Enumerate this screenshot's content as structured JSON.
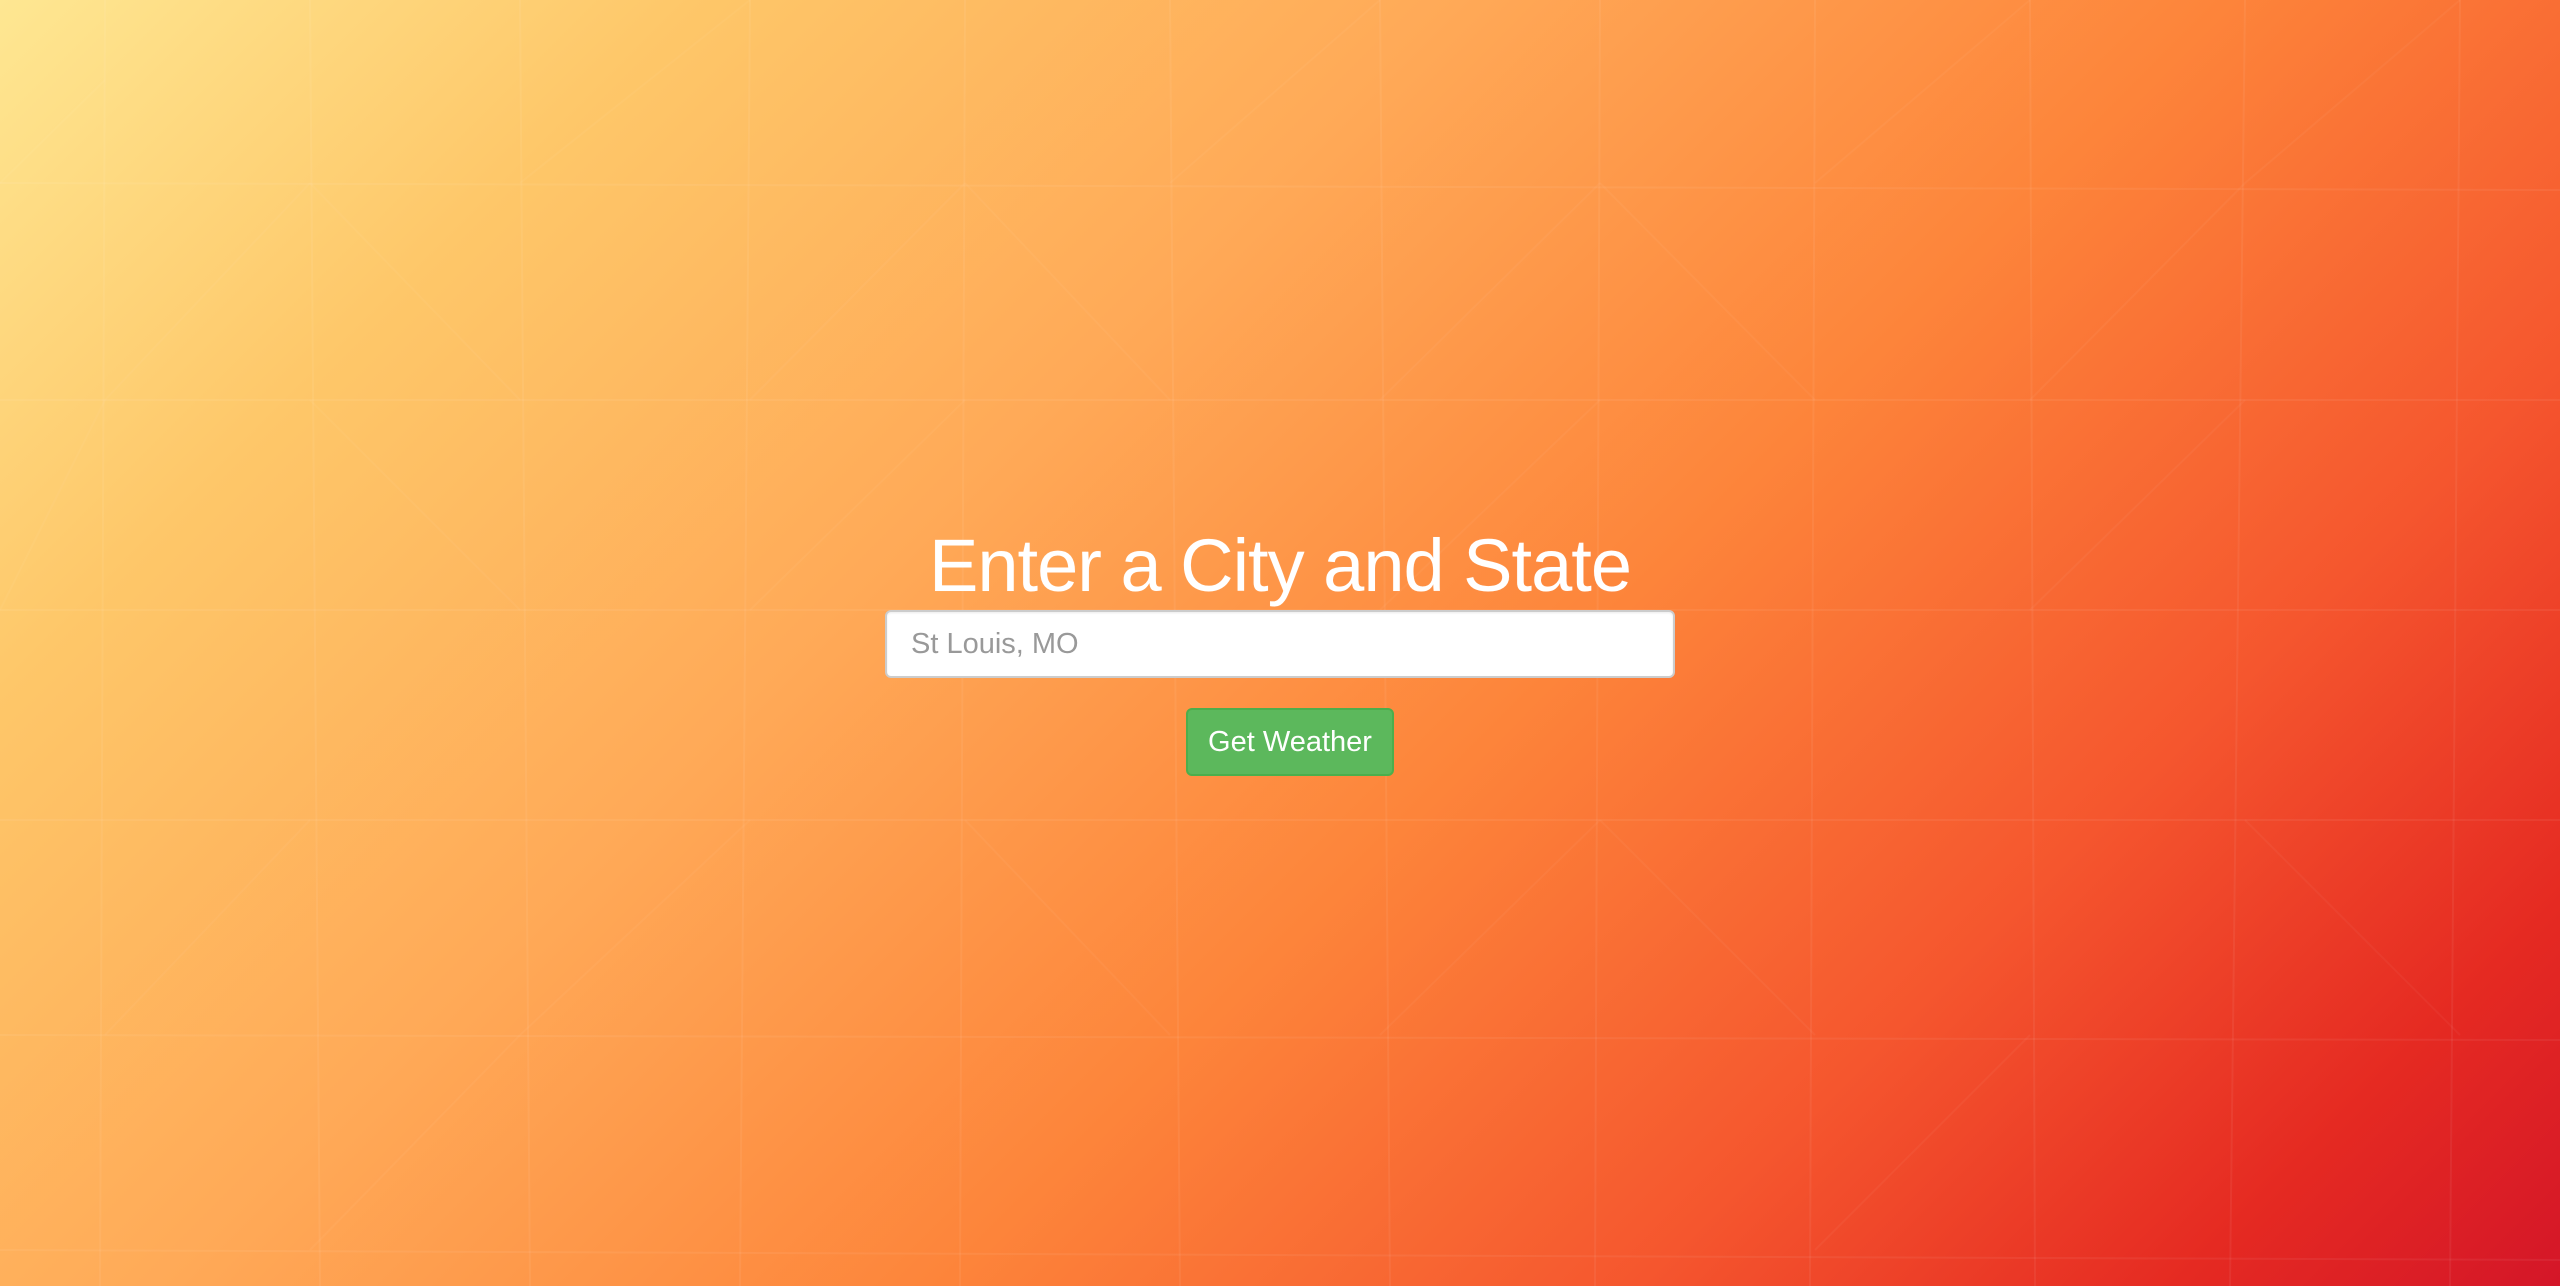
{
  "page": {
    "title": "Enter a City and State"
  },
  "search": {
    "placeholder": "St Louis, MO",
    "value": ""
  },
  "actions": {
    "get_weather_label": "Get Weather"
  },
  "colors": {
    "button_background": "#5cb85c",
    "button_border": "#4cae4c",
    "title_text": "#ffffff",
    "background_top_left": "#fee792",
    "background_bottom_right": "#d41628"
  }
}
